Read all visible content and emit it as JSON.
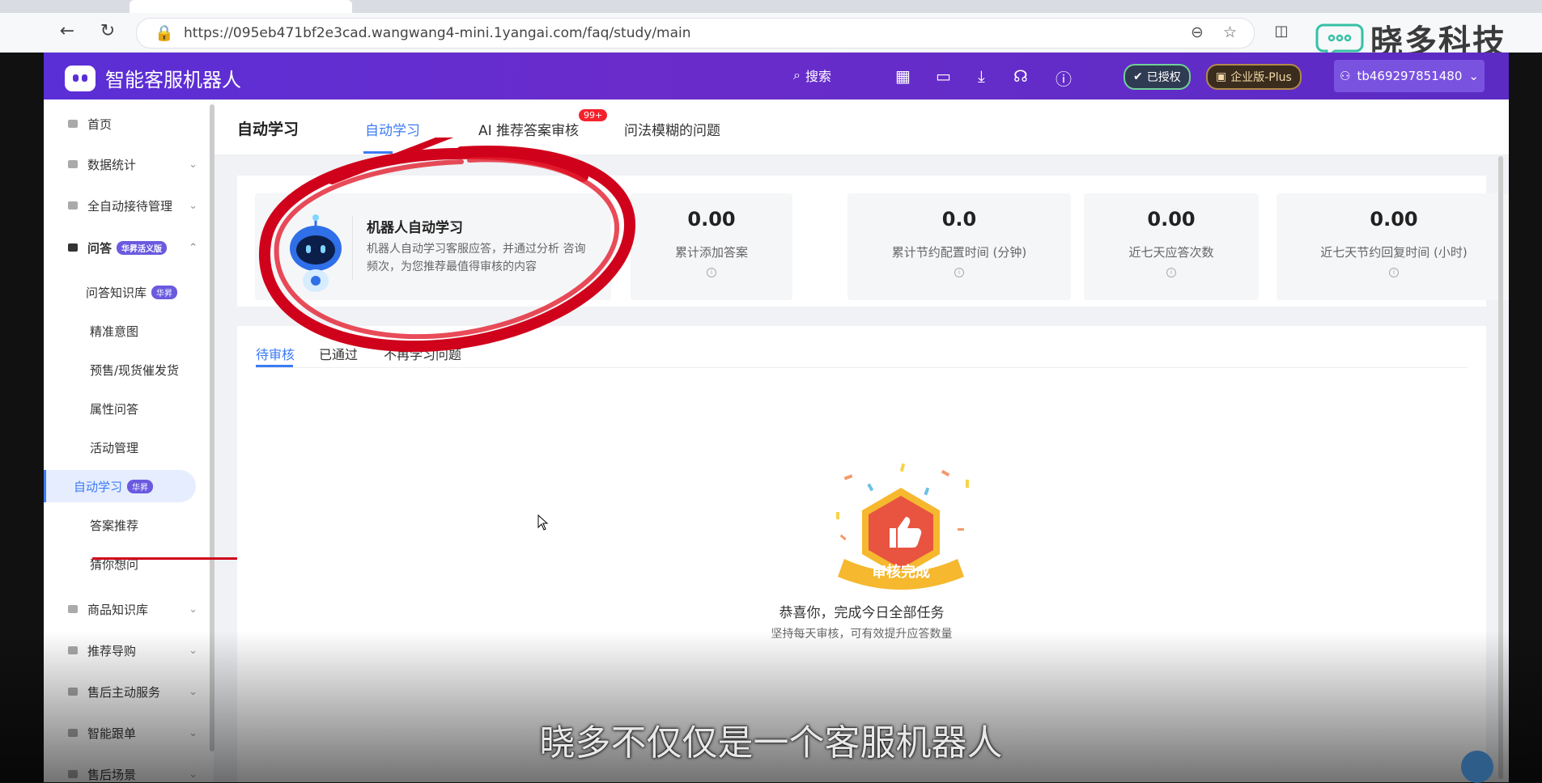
{
  "browser": {
    "url": "https://095eb471bf2e3cad.wangwang4-mini.1yangai.com/faq/study/main",
    "watermark": "晓多科技"
  },
  "topbar": {
    "app_name": "智能客服机器人",
    "search_label": "搜索",
    "auth_label": "已授权",
    "edition_label": "企业版-Plus",
    "username": "tb469297851480"
  },
  "sidebar": {
    "home": "首页",
    "stats": "数据统计",
    "auto_reception": "全自动接待管理",
    "qa": "问答",
    "qa_tag": "华昇活义版",
    "qa_kb": "问答知识库",
    "qa_kb_tag": "华昇",
    "intent": "精准意图",
    "presale": "预售/现货催发货",
    "attr_qa": "属性问答",
    "activity": "活动管理",
    "auto_learn": "自动学习",
    "auto_learn_tag": "华昇",
    "answer_rec": "答案推荐",
    "guess": "猜你想问",
    "product_kb": "商品知识库",
    "guide": "推荐导购",
    "after_sale": "售后主动服务",
    "order_follow": "智能跟单",
    "after_scene": "售后场景"
  },
  "page": {
    "title": "自动学习",
    "tabs": [
      "自动学习",
      "AI 推荐答案审核",
      "问法模糊的问题"
    ],
    "review_count": "99+"
  },
  "intro": {
    "title": "机器人自动学习",
    "desc": "机器人自动学习客服应答，并通过分析 咨询频次，为您推荐最值得审核的内容"
  },
  "stats": [
    {
      "value": "0.00",
      "label": "累计添加答案"
    },
    {
      "value": "0.0",
      "label": "累计节约配置时间 (分钟)"
    },
    {
      "value": "0.00",
      "label": "近七天应答次数"
    },
    {
      "value": "0.00",
      "label": "近七天节约回复时间 (小时)"
    }
  ],
  "list_tabs": [
    "待审核",
    "已通过",
    "不再学习问题"
  ],
  "empty": {
    "badge_text": "审核完成",
    "message": "恭喜你，完成今日全部任务",
    "sub": "坚持每天审核，可有效提升应答数量"
  },
  "subtitle": "晓多不仅仅是一个客服机器人",
  "colors": {
    "brand": "#5a2fd6",
    "accent": "#3c7bf4",
    "annotation": "#d0021b"
  }
}
